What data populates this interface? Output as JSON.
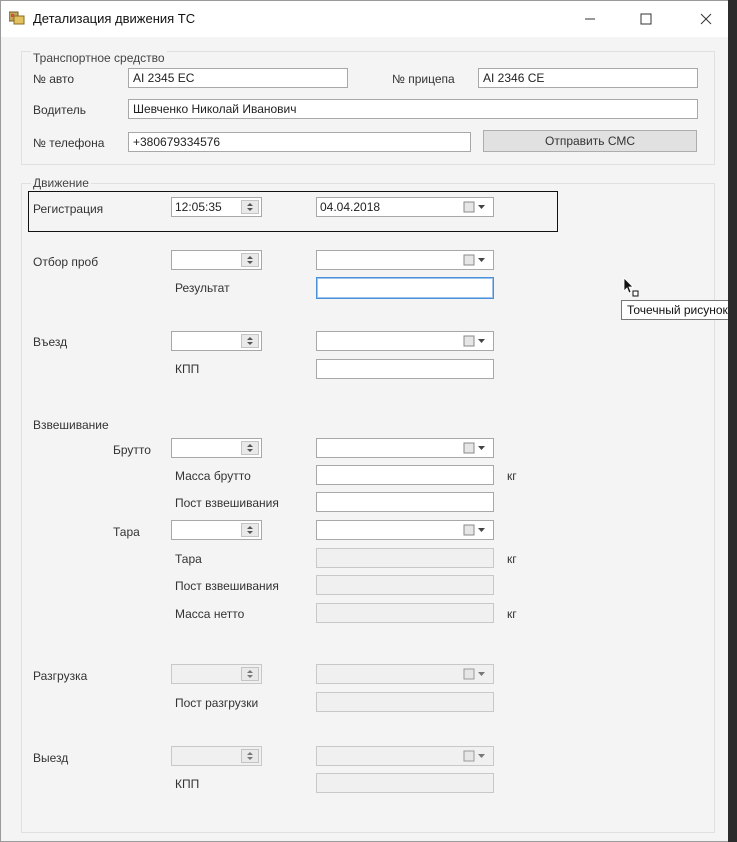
{
  "window": {
    "title": "Детализация движения ТС"
  },
  "vehicle_group": {
    "label": "Транспортное средство",
    "auto_number_label": "№ авто",
    "auto_number_value": "AI 2345 EC",
    "trailer_number_label": "№ прицепа",
    "trailer_number_value": "AI 2346 CE",
    "driver_label": "Водитель",
    "driver_value": "Шевченко Николай Иванович",
    "phone_label": "№ телефона",
    "phone_value": "+380679334576",
    "send_sms_label": "Отправить СМС"
  },
  "movement_group": {
    "label": "Движение",
    "registration": {
      "label": "Регистрация",
      "time": "12:05:35",
      "date": "04.04.2018"
    },
    "sampling": {
      "label": "Отбор проб",
      "result_label": "Результат"
    },
    "entry": {
      "label": "Въезд",
      "checkpoint_label": "КПП"
    },
    "weighing": {
      "label": "Взвешивание",
      "gross_label": "Брутто",
      "gross_mass_label": "Масса брутто",
      "gross_post_label": "Пост взвешивания",
      "tare_label": "Тара",
      "tare_value_label": "Тара",
      "tare_post_label": "Пост взвешивания",
      "net_mass_label": "Масса нетто",
      "unit_kg": "кг"
    },
    "unloading": {
      "label": "Разгрузка",
      "post_label": "Пост разгрузки"
    },
    "exit": {
      "label": "Выезд",
      "checkpoint_label": "КПП"
    }
  },
  "tooltip": {
    "text": "Точечный рисунок"
  }
}
